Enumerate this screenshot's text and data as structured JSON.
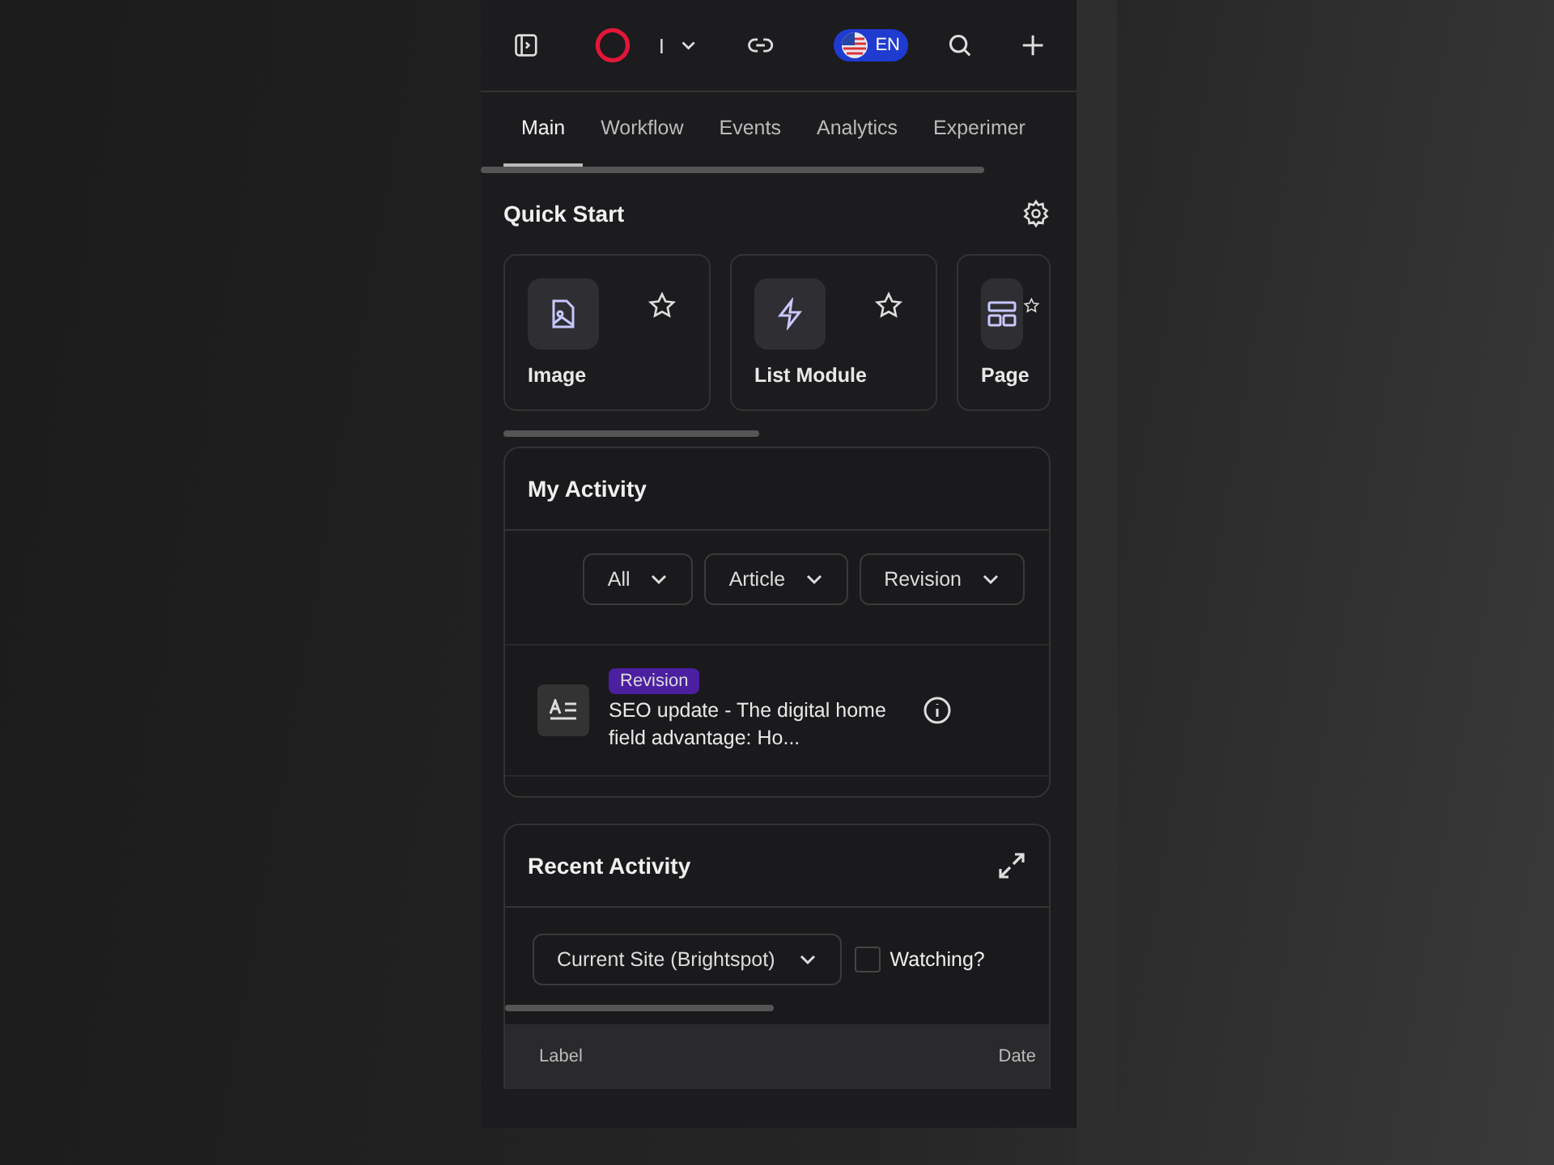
{
  "header": {
    "org_initial": "I",
    "language": "EN"
  },
  "tabs": [
    {
      "label": "Main",
      "selected": true
    },
    {
      "label": "Workflow",
      "selected": false
    },
    {
      "label": "Events",
      "selected": false
    },
    {
      "label": "Analytics",
      "selected": false
    },
    {
      "label": "Experimer",
      "selected": false
    }
  ],
  "quick_start": {
    "title": "Quick Start",
    "items": [
      {
        "label": "Image",
        "kind": "image"
      },
      {
        "label": "List Module",
        "kind": "bolt"
      },
      {
        "label": "Page",
        "kind": "layout"
      }
    ]
  },
  "my_activity": {
    "title": "My Activity",
    "filters": [
      "All",
      "Article",
      "Revision"
    ],
    "items": [
      {
        "tag": "Revision",
        "title": "SEO update - The digital home field advantage: Ho..."
      }
    ]
  },
  "recent_activity": {
    "title": "Recent Activity",
    "site_select": "Current Site (Brightspot)",
    "watching": {
      "label": "Watching?",
      "checked": false
    },
    "table": {
      "columns": [
        "Label",
        "Date"
      ]
    }
  }
}
